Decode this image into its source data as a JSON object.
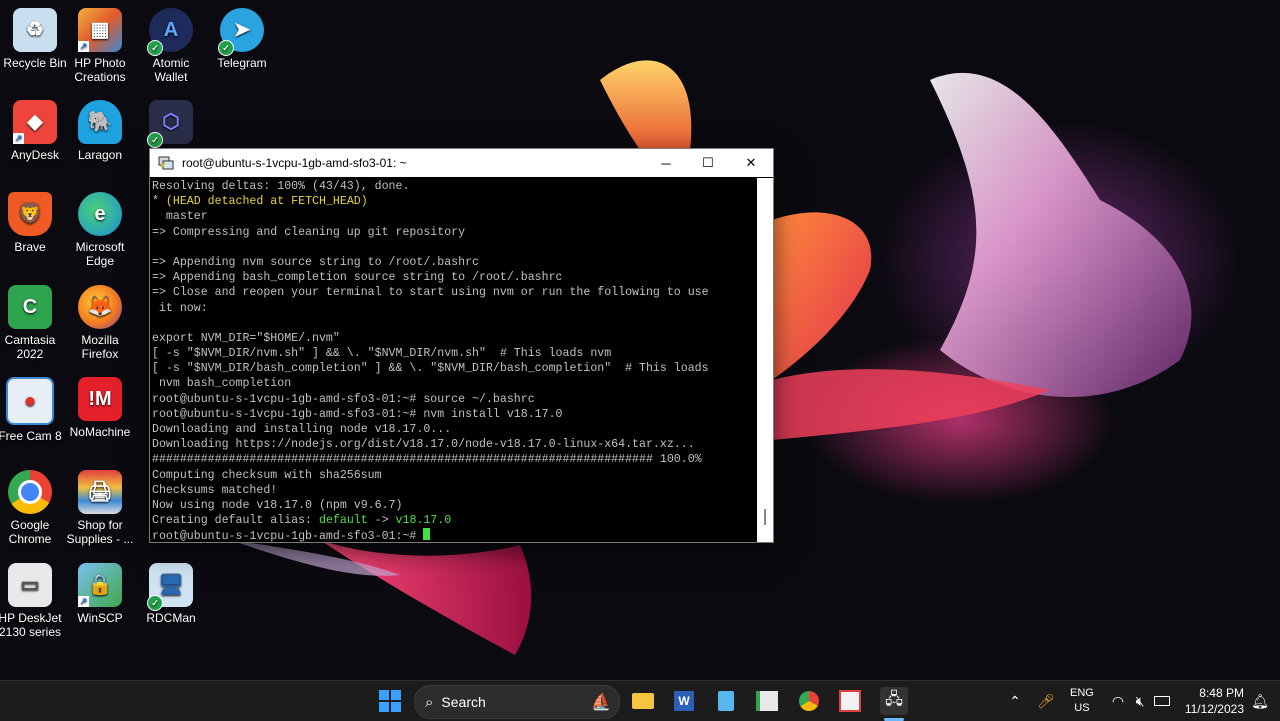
{
  "desktop": {
    "icons": [
      {
        "label": "Recycle Bin",
        "icon": "recycle-bin-icon",
        "color": "#4aa3df"
      },
      {
        "label": "HP Photo\nCreations",
        "icon": "hp-photo-icon",
        "color": "#e86a2c"
      },
      {
        "label": "Atomic\nWallet",
        "icon": "atomic-wallet-icon",
        "color": "#1d2a5a"
      },
      {
        "label": "Telegram",
        "icon": "telegram-icon",
        "color": "#2aa3e0"
      },
      {
        "label": "AnyDesk",
        "icon": "anydesk-icon",
        "color": "#ef443b"
      },
      {
        "label": "Laragon",
        "icon": "laragon-icon",
        "color": "#1ea2e0"
      },
      {
        "label": "",
        "icon": "exodus-icon",
        "color": "#2a2e4a"
      },
      {
        "label": "Brave",
        "icon": "brave-icon",
        "color": "#f05a24"
      },
      {
        "label": "Microsoft\nEdge",
        "icon": "edge-icon",
        "color": "#1a8fd6"
      },
      {
        "label": "Camtasia\n2022",
        "icon": "camtasia-icon",
        "color": "#2ea44f"
      },
      {
        "label": "Mozilla\nFirefox",
        "icon": "firefox-icon",
        "color": "#f57c20"
      },
      {
        "label": "Free Cam 8",
        "icon": "free-cam-icon",
        "color": "#e8eef5"
      },
      {
        "label": "NoMachine",
        "icon": "nomachine-icon",
        "color": "#e4202b"
      },
      {
        "label": "Google\nChrome",
        "icon": "chrome-icon",
        "color": "#e9b524"
      },
      {
        "label": "Shop for\nSupplies - ...",
        "icon": "shop-supplies-icon",
        "color": "#d9d9d9"
      },
      {
        "label": "HP DeskJet\n2130 series",
        "icon": "printer-icon",
        "color": "#e9e9e9"
      },
      {
        "label": "WinSCP",
        "icon": "winscp-icon",
        "color": "#3ea84a"
      },
      {
        "label": "RDCMan",
        "icon": "rdcman-icon",
        "color": "#5aa0d6"
      }
    ]
  },
  "window": {
    "title": "root@ubuntu-s-1vcpu-1gb-amd-sfo3-01: ~",
    "minimize": "─",
    "maximize": "☐",
    "close": "✕"
  },
  "terminal": {
    "lines": [
      {
        "segments": [
          {
            "t": "Resolving deltas: 100% (43/43), done.",
            "c": ""
          }
        ]
      },
      {
        "segments": [
          {
            "t": "* ",
            "c": ""
          },
          {
            "t": "(HEAD detached at FETCH_HEAD)",
            "c": "yellow"
          }
        ]
      },
      {
        "segments": [
          {
            "t": "  master",
            "c": ""
          }
        ]
      },
      {
        "segments": [
          {
            "t": "=> Compressing and cleaning up git repository",
            "c": ""
          }
        ]
      },
      {
        "segments": [
          {
            "t": "",
            "c": ""
          }
        ]
      },
      {
        "segments": [
          {
            "t": "=> Appending nvm source string to /root/.bashrc",
            "c": ""
          }
        ]
      },
      {
        "segments": [
          {
            "t": "=> Appending bash_completion source string to /root/.bashrc",
            "c": ""
          }
        ]
      },
      {
        "segments": [
          {
            "t": "=> Close and reopen your terminal to start using nvm or run the following to use",
            "c": ""
          }
        ]
      },
      {
        "segments": [
          {
            "t": " it now:",
            "c": ""
          }
        ]
      },
      {
        "segments": [
          {
            "t": "",
            "c": ""
          }
        ]
      },
      {
        "segments": [
          {
            "t": "export NVM_DIR=\"$HOME/.nvm\"",
            "c": ""
          }
        ]
      },
      {
        "segments": [
          {
            "t": "[ -s \"$NVM_DIR/nvm.sh\" ] && \\. \"$NVM_DIR/nvm.sh\"  # This loads nvm",
            "c": ""
          }
        ]
      },
      {
        "segments": [
          {
            "t": "[ -s \"$NVM_DIR/bash_completion\" ] && \\. \"$NVM_DIR/bash_completion\"  # This loads",
            "c": ""
          }
        ]
      },
      {
        "segments": [
          {
            "t": " nvm bash_completion",
            "c": ""
          }
        ]
      },
      {
        "segments": [
          {
            "t": "root@ubuntu-s-1vcpu-1gb-amd-sfo3-01:~# source ~/.bashrc",
            "c": ""
          }
        ]
      },
      {
        "segments": [
          {
            "t": "root@ubuntu-s-1vcpu-1gb-amd-sfo3-01:~# nvm install v18.17.0",
            "c": ""
          }
        ]
      },
      {
        "segments": [
          {
            "t": "Downloading and installing node v18.17.0...",
            "c": ""
          }
        ]
      },
      {
        "segments": [
          {
            "t": "Downloading https://nodejs.org/dist/v18.17.0/node-v18.17.0-linux-x64.tar.xz...",
            "c": ""
          }
        ]
      },
      {
        "segments": [
          {
            "t": "######################################################################## 100.0%",
            "c": ""
          }
        ]
      },
      {
        "segments": [
          {
            "t": "Computing checksum with sha256sum",
            "c": ""
          }
        ]
      },
      {
        "segments": [
          {
            "t": "Checksums matched!",
            "c": ""
          }
        ]
      },
      {
        "segments": [
          {
            "t": "Now using node v18.17.0 (npm v9.6.7)",
            "c": ""
          }
        ]
      },
      {
        "segments": [
          {
            "t": "Creating default alias: ",
            "c": ""
          },
          {
            "t": "default",
            "c": "green"
          },
          {
            "t": " -> ",
            "c": ""
          },
          {
            "t": "v18.17.0",
            "c": "green"
          }
        ]
      },
      {
        "segments": [
          {
            "t": "root@ubuntu-s-1vcpu-1gb-amd-sfo3-01:~# ",
            "c": ""
          }
        ],
        "cursor": true
      }
    ]
  },
  "taskbar": {
    "search_label": "Search",
    "apps": [
      "start-icon",
      "search-icon",
      "file-explorer-icon",
      "word-icon",
      "notepad-icon",
      "sheets-icon",
      "chrome-icon",
      "snipping-icon",
      "putty-icon"
    ],
    "tray": {
      "lang_line1": "ENG",
      "lang_line2": "US",
      "time": "8:48 PM",
      "date": "11/12/2023"
    }
  }
}
